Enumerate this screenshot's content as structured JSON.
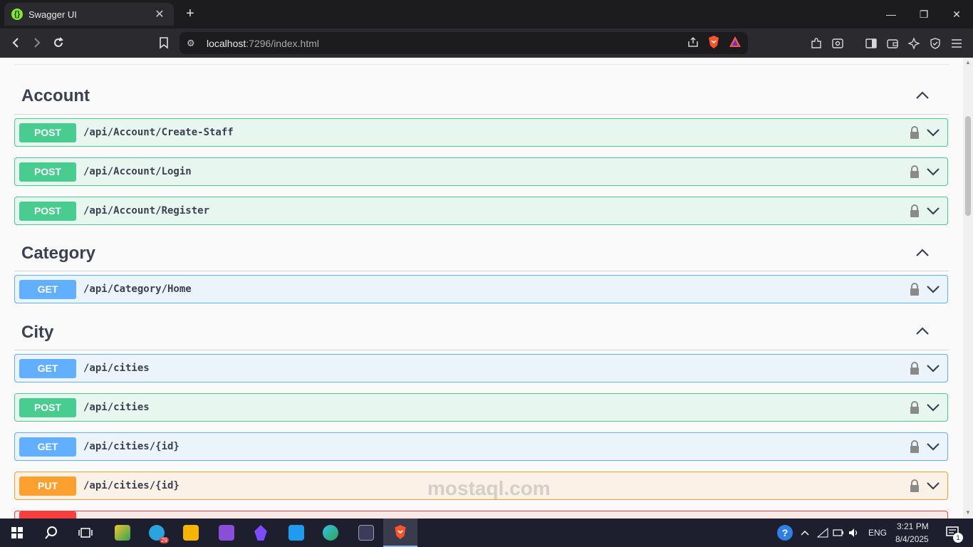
{
  "browser": {
    "tab_title": "Swagger UI",
    "url_host": "localhost",
    "url_rest": ":7296/index.html"
  },
  "sections": [
    {
      "title": "Account",
      "operations": [
        {
          "method": "POST",
          "path": "/api/Account/Create-Staff"
        },
        {
          "method": "POST",
          "path": "/api/Account/Login"
        },
        {
          "method": "POST",
          "path": "/api/Account/Register"
        }
      ]
    },
    {
      "title": "Category",
      "operations": [
        {
          "method": "GET",
          "path": "/api/Category/Home"
        }
      ]
    },
    {
      "title": "City",
      "operations": [
        {
          "method": "GET",
          "path": "/api/cities"
        },
        {
          "method": "POST",
          "path": "/api/cities"
        },
        {
          "method": "GET",
          "path": "/api/cities/{id}"
        },
        {
          "method": "PUT",
          "path": "/api/cities/{id}"
        }
      ]
    }
  ],
  "taskbar": {
    "telegram_badge": "29",
    "language": "ENG",
    "time": "3:21 PM",
    "date": "8/4/2025",
    "notification_count": "1"
  },
  "watermark": {
    "text": "mostaql.com"
  },
  "colors": {
    "post": "#49cc90",
    "get": "#61affe",
    "put": "#fca130",
    "delete": "#f93e3e"
  }
}
